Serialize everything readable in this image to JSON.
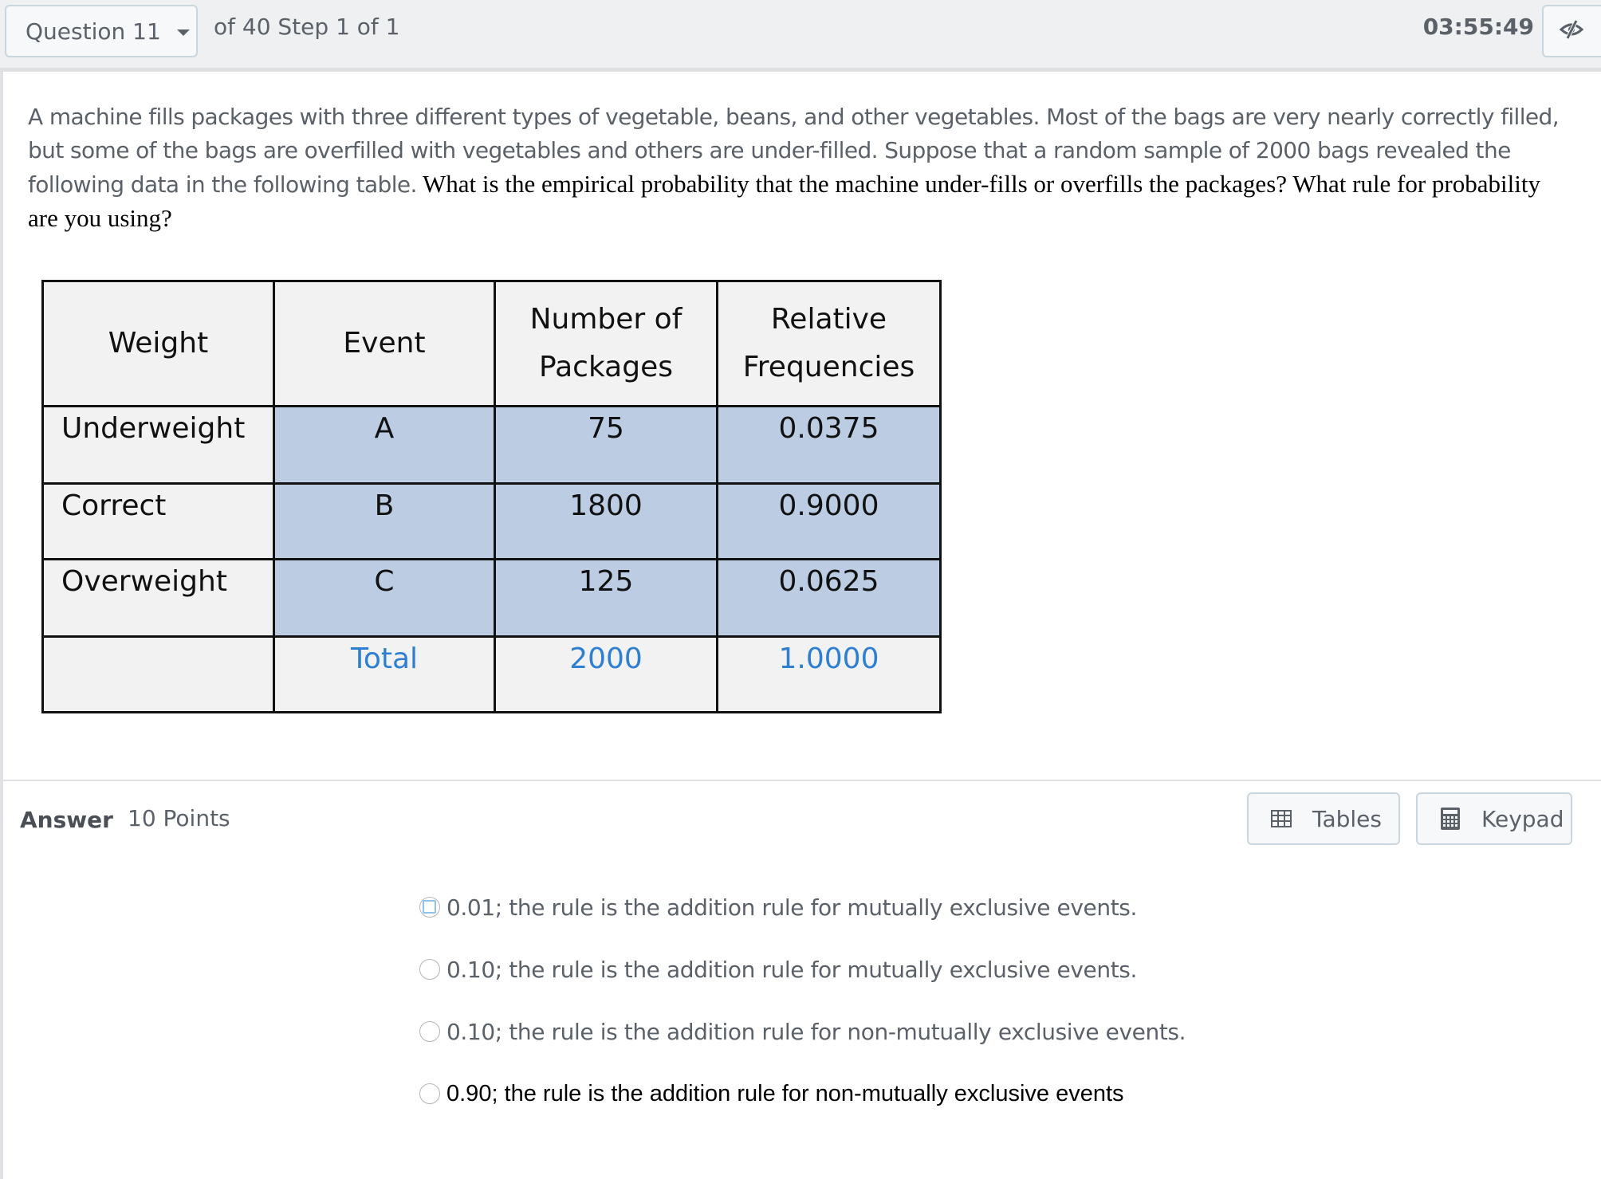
{
  "header": {
    "question_selector": "Question 11",
    "step_text": "of 40 Step 1 of 1",
    "timer": "03:55:49",
    "visibility_icon": "eye-slash-icon"
  },
  "question": {
    "intro": "A machine fills packages with three different types of vegetable, beans, and other vegetables.  Most of the bags are very nearly correctly filled, but some of the bags are overfilled with vegetables and others are under-filled.  Suppose that a random sample of 2000 bags revealed the following data in the following table.",
    "prompt": " What is the empirical probability that the machine under-fills or overfills the packages?  What rule for probability are you using?"
  },
  "table": {
    "headers": [
      "Weight",
      "Event",
      "Number of Packages",
      "Relative Frequencies"
    ],
    "header_lines": [
      [
        "Weight"
      ],
      [
        "Event"
      ],
      [
        "Number of",
        "Packages"
      ],
      [
        "Relative",
        "Frequencies"
      ]
    ],
    "rows": [
      {
        "weight": "Underweight",
        "event": "A",
        "packages": "75",
        "relative": "0.0375"
      },
      {
        "weight": "Correct",
        "event": "B",
        "packages": "1800",
        "relative": "0.9000"
      },
      {
        "weight": "Overweight",
        "event": "C",
        "packages": "125",
        "relative": "0.0625"
      }
    ],
    "total": {
      "weight": "",
      "event": "Total",
      "packages": "2000",
      "relative": "1.0000"
    }
  },
  "answer": {
    "label": "Answer",
    "points": "10 Points",
    "tables_button": "Tables",
    "keypad_button": "Keypad"
  },
  "options": [
    {
      "text": "0.01; the rule is the addition rule for mutually exclusive events.",
      "selected": false,
      "focused": true
    },
    {
      "text": "0.10; the rule is the addition rule for mutually exclusive events.",
      "selected": false,
      "focused": false
    },
    {
      "text": "0.10; the rule is the addition rule for non-mutually exclusive events.",
      "selected": false,
      "focused": false
    },
    {
      "text": "0.90; the rule is the addition rule for non-mutually exclusive events",
      "selected": false,
      "focused": false
    }
  ],
  "colors": {
    "table_highlight": "#bccde3",
    "total_text": "#2f7fd0",
    "focus_outline": "#8fc3ea"
  }
}
